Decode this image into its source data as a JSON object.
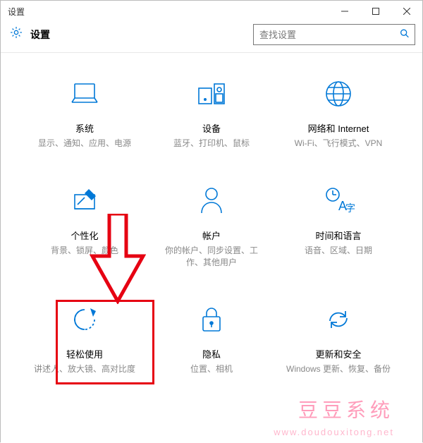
{
  "window": {
    "title": "设置",
    "app_title": "设置"
  },
  "search": {
    "placeholder": "查找设置"
  },
  "tiles": [
    {
      "title": "系统",
      "desc": "显示、通知、应用、电源"
    },
    {
      "title": "设备",
      "desc": "蓝牙、打印机、鼠标"
    },
    {
      "title": "网络和 Internet",
      "desc": "Wi-Fi、飞行模式、VPN"
    },
    {
      "title": "个性化",
      "desc": "背景、锁屏、颜色"
    },
    {
      "title": "帐户",
      "desc": "你的帐户、同步设置、工作、其他用户"
    },
    {
      "title": "时间和语言",
      "desc": "语音、区域、日期"
    },
    {
      "title": "轻松使用",
      "desc": "讲述人、放大镜、高对比度"
    },
    {
      "title": "隐私",
      "desc": "位置、相机"
    },
    {
      "title": "更新和安全",
      "desc": "Windows 更新、恢复、备份"
    }
  ],
  "annotation": {
    "highlight_tile_index": 6
  },
  "watermark": {
    "text1": "豆豆系统",
    "text2": "www.doudouxitong.net"
  },
  "colors": {
    "accent": "#0078d7",
    "highlight": "#e60012",
    "watermark": "#ff9dbb"
  }
}
